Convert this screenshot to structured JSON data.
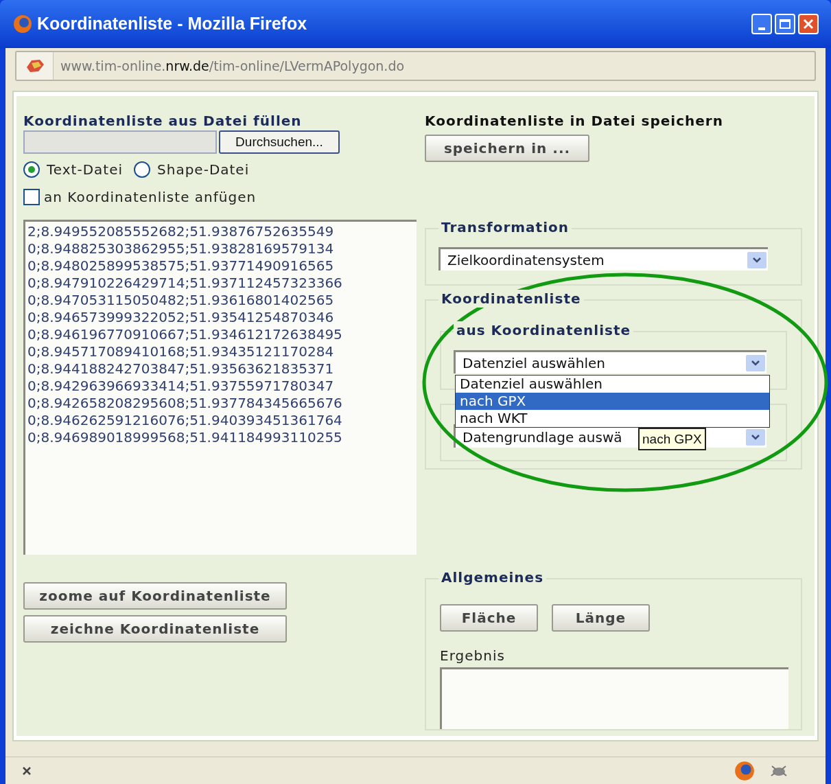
{
  "window": {
    "title": "Koordinatenliste - Mozilla Firefox"
  },
  "address": {
    "prefix": "www.tim-online.",
    "domain": "nrw.de",
    "path": "/tim-online/LVermAPolygon.do"
  },
  "left": {
    "heading": "Koordinatenliste aus Datei füllen",
    "browse_button": "Durchsuchen...",
    "radios": [
      {
        "label": "Text-Datei",
        "selected": true
      },
      {
        "label": "Shape-Datei",
        "selected": false
      }
    ],
    "checkbox": {
      "label": "an Koordinatenliste anfügen",
      "checked": false
    },
    "lines": [
      "2;8.949552085552682;51.93876752635549",
      "0;8.948825303862955;51.93828169579134",
      "0;8.948025899538575;51.93771490916565",
      "0;8.947910226429714;51.937112457323366",
      "0;8.947053115050482;51.93616801402565",
      "0;8.946573999322052;51.93541254870346",
      "0;8.946196770910667;51.934612172638495",
      "0;8.945717089410168;51.93435121170284",
      "0;8.944188242703847;51.93563621835371",
      "0;8.942963966933414;51.93755971780347",
      "0;8.942658208295608;51.937784345665676",
      "0;8.946262591216076;51.940393451361764",
      "0;8.946989018999568;51.941184993110255"
    ],
    "buttons": [
      "zoome auf Koordinatenliste",
      "zeichne Koordinatenliste"
    ]
  },
  "right": {
    "heading": "Koordinatenliste in Datei speichern",
    "save_button": "speichern in ...",
    "transformation": {
      "legend": "Transformation",
      "select": "Zielkoordinatensystem"
    },
    "koordinatenliste": {
      "legend": "Koordinatenliste",
      "sub_legend": "aus Koordinatenliste",
      "select": "Datenziel auswählen",
      "options": [
        {
          "label": "Datenziel auswählen",
          "selected": false
        },
        {
          "label": "nach GPX",
          "selected": true
        },
        {
          "label": "nach WKT",
          "selected": false
        }
      ],
      "second_select": "Datengrundlage auswä",
      "tooltip": "nach GPX"
    },
    "allgemeines": {
      "legend": "Allgemeines",
      "buttons": [
        "Fläche",
        "Länge"
      ],
      "result_label": "Ergebnis"
    }
  }
}
